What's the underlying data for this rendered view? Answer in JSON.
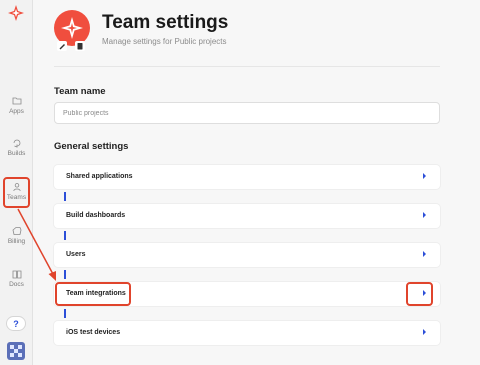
{
  "sidebar": {
    "items": [
      {
        "label": "Apps",
        "icon": "folder-icon"
      },
      {
        "label": "Builds",
        "icon": "builds-icon"
      },
      {
        "label": "Teams",
        "icon": "person-icon"
      },
      {
        "label": "Billing",
        "icon": "billing-icon"
      },
      {
        "label": "Docs",
        "icon": "docs-icon"
      }
    ],
    "help_label": "?"
  },
  "header": {
    "title": "Team settings",
    "subtitle": "Manage settings for Public projects"
  },
  "team_name": {
    "label": "Team name",
    "value": "Public projects"
  },
  "general_settings": {
    "label": "General settings",
    "rows": [
      {
        "label": "Shared applications"
      },
      {
        "label": "Build dashboards"
      },
      {
        "label": "Users"
      },
      {
        "label": "Team integrations"
      },
      {
        "label": "iOS test devices"
      }
    ]
  },
  "colors": {
    "accent": "#2c4fd8",
    "brand": "#f04e3e",
    "annotation": "#e0442c"
  }
}
